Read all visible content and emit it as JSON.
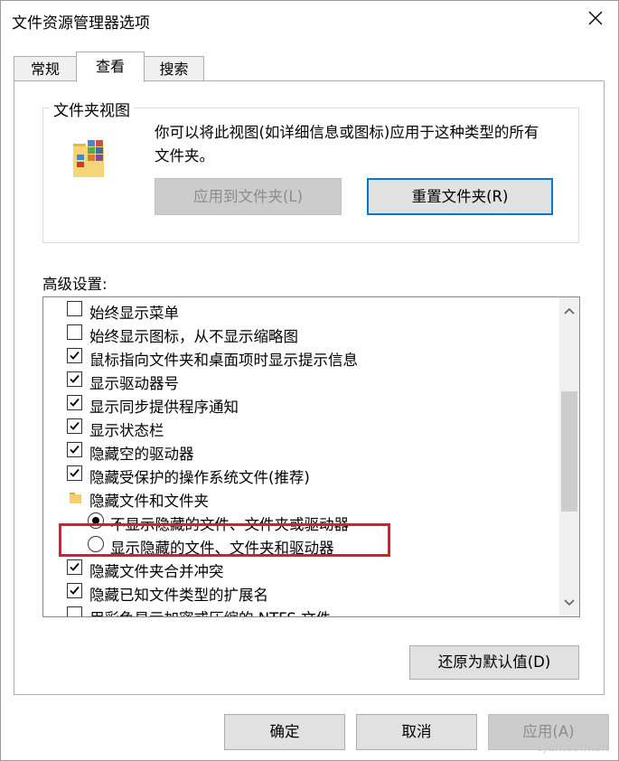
{
  "window": {
    "title": "文件资源管理器选项"
  },
  "tabs": [
    {
      "label": "常规",
      "active": false
    },
    {
      "label": "查看",
      "active": true
    },
    {
      "label": "搜索",
      "active": false
    }
  ],
  "folder_views": {
    "title": "文件夹视图",
    "description_line1": "你可以将此视图(如详细信息或图标)应用于这种类型的所有",
    "description_line2": "文件夹。",
    "apply_button": "应用到文件夹(L)",
    "reset_button": "重置文件夹(R)"
  },
  "advanced": {
    "label": "高级设置:",
    "items": [
      {
        "type": "checkbox",
        "checked": false,
        "label": "始终显示菜单"
      },
      {
        "type": "checkbox",
        "checked": false,
        "label": "始终显示图标，从不显示缩略图"
      },
      {
        "type": "checkbox",
        "checked": true,
        "label": "鼠标指向文件夹和桌面项时显示提示信息"
      },
      {
        "type": "checkbox",
        "checked": true,
        "label": "显示驱动器号"
      },
      {
        "type": "checkbox",
        "checked": true,
        "label": "显示同步提供程序通知"
      },
      {
        "type": "checkbox",
        "checked": true,
        "label": "显示状态栏"
      },
      {
        "type": "checkbox",
        "checked": true,
        "label": "隐藏空的驱动器"
      },
      {
        "type": "checkbox",
        "checked": true,
        "label": "隐藏受保护的操作系统文件(推荐)"
      },
      {
        "type": "folder",
        "label": "隐藏文件和文件夹"
      },
      {
        "type": "radio",
        "checked": true,
        "label": "不显示隐藏的文件、文件夹或驱动器"
      },
      {
        "type": "radio",
        "checked": false,
        "label": "显示隐藏的文件、文件夹和驱动器"
      },
      {
        "type": "checkbox",
        "checked": true,
        "label": "隐藏文件夹合并冲突"
      },
      {
        "type": "checkbox",
        "checked": true,
        "label": "隐藏已知文件类型的扩展名"
      },
      {
        "type": "checkbox",
        "checked": false,
        "label": "用彩色显示加密或压缩的 NTFS 文件"
      }
    ],
    "restore_button": "还原为默认值(D)"
  },
  "footer": {
    "ok": "确定",
    "cancel": "取消",
    "apply": "应用(A)"
  },
  "watermark": "cfan.com.cn",
  "colors": {
    "highlight": "#e01b24",
    "accent": "#0078d7"
  }
}
